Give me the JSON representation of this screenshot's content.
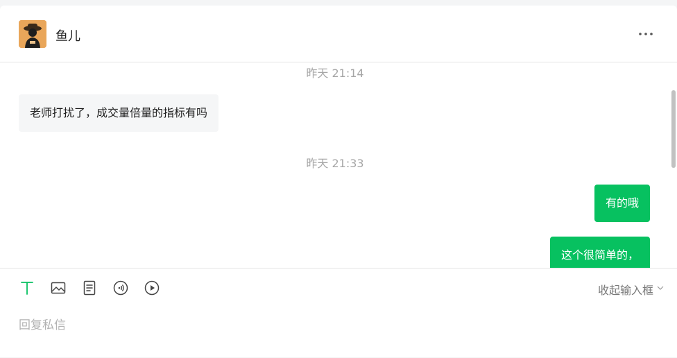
{
  "header": {
    "contact_name": "鱼儿",
    "avatar": "avatar-icon",
    "more_icon": "more-dots-icon"
  },
  "messages": [
    {
      "type": "time",
      "text": "昨天 21:14"
    },
    {
      "type": "incoming",
      "text": "老师打扰了，成交量倍量的指标有吗"
    },
    {
      "type": "time",
      "text": "昨天 21:33"
    },
    {
      "type": "outgoing",
      "text": "有的哦"
    },
    {
      "type": "outgoing",
      "text": "这个很简单的，"
    }
  ],
  "composer": {
    "tools": [
      "text-icon",
      "image-icon",
      "document-icon",
      "audio-icon",
      "video-play-icon"
    ],
    "collapse_label": "收起输入框",
    "placeholder": "回复私信"
  },
  "colors": {
    "accent": "#07c160",
    "incoming_bubble": "#f5f6f7",
    "timestamp": "#a6a6a6"
  }
}
